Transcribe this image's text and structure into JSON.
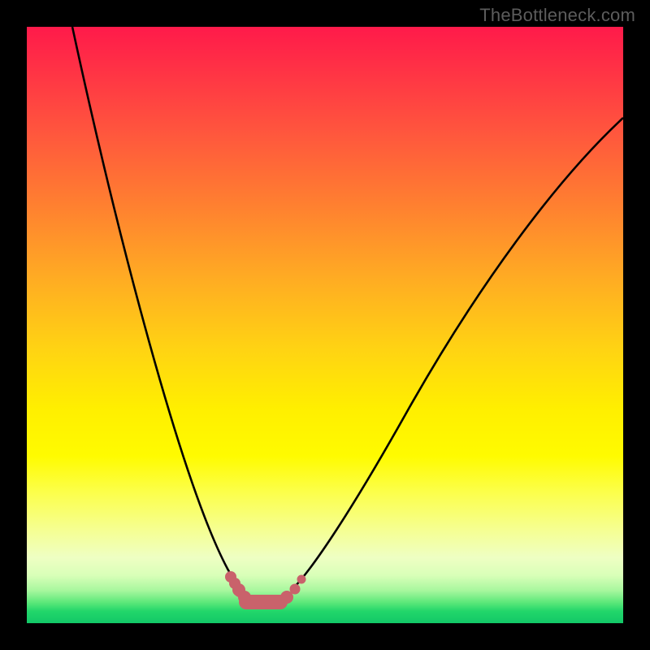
{
  "watermark": "TheBottleneck.com",
  "chart_data": {
    "type": "line",
    "title": "",
    "xlabel": "",
    "ylabel": "",
    "xlim": [
      0,
      100
    ],
    "ylim": [
      0,
      100
    ],
    "background_gradient": {
      "direction": "vertical",
      "stops": [
        {
          "pos": 0.0,
          "color": "#ff1a4a"
        },
        {
          "pos": 0.18,
          "color": "#ff573d"
        },
        {
          "pos": 0.42,
          "color": "#ffab23"
        },
        {
          "pos": 0.64,
          "color": "#ffef00"
        },
        {
          "pos": 0.84,
          "color": "#f6ff8e"
        },
        {
          "pos": 0.96,
          "color": "#5de87a"
        },
        {
          "pos": 1.0,
          "color": "#12c867"
        }
      ]
    },
    "series": [
      {
        "name": "V-curve",
        "color": "#000000",
        "x": [
          7,
          12,
          18,
          24,
          30,
          34,
          37,
          41,
          44,
          50,
          58,
          68,
          80,
          92,
          100
        ],
        "y": [
          100,
          80,
          58,
          38,
          20,
          10,
          5,
          3,
          5,
          12,
          25,
          42,
          62,
          80,
          90
        ]
      }
    ],
    "trough_marker": {
      "color": "#c9626b",
      "x_range": [
        34,
        46
      ],
      "y": 3
    }
  }
}
